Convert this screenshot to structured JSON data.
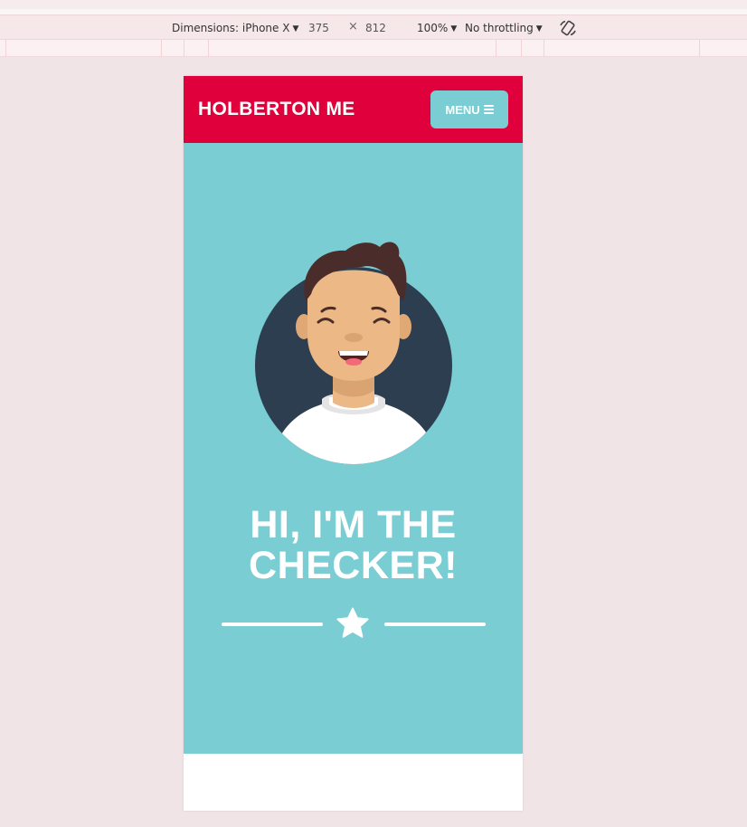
{
  "devtools": {
    "dimensions_label": "Dimensions: iPhone X",
    "width_value": "375",
    "times_sign": "×",
    "height_value": "812",
    "zoom_value": "100%",
    "throttling_value": "No throttling",
    "rotate_icon": "rotate-icon",
    "caret_icon": "triangle-down"
  },
  "site": {
    "brand": "HOLBERTON ME",
    "menu_label": "MENU",
    "menu_icon": "hamburger-icon",
    "hero_title_line1": "HI, I'M THE",
    "hero_title_line2": "CHECKER!",
    "divider_icon": "star-icon"
  },
  "colors": {
    "header_red": "#e0003c",
    "teal": "#79cdd3",
    "avatar_circle": "#2d3e50",
    "hair": "#4a2c2a",
    "skin": "#ebb886",
    "shirt": "#ffffff"
  }
}
